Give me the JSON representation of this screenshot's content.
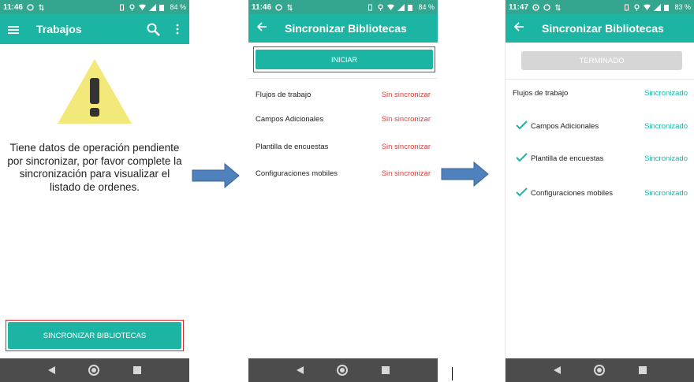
{
  "screen1": {
    "status": {
      "time": "11:46",
      "battery": "84 %"
    },
    "appbar": {
      "title": "Trabajos"
    },
    "message": "Tiene datos de operación pendiente por sincronizar, por favor complete la sincronización para visualizar el listado de ordenes.",
    "sync_button": "SINCRONIZAR BIBLIOTECAS"
  },
  "screen2": {
    "status": {
      "time": "11:46",
      "battery": "84 %"
    },
    "appbar": {
      "title": "Sincronizar Bibliotecas"
    },
    "start_button": "INICIAR",
    "rows": [
      {
        "label": "Flujos de trabajo",
        "status": "Sin sincronizar"
      },
      {
        "label": "Campos Adicionales",
        "status": "Sin sincronizar"
      },
      {
        "label": "Plantilla de encuestas",
        "status": "Sin sincronizar"
      },
      {
        "label": "Configuraciones mobiles",
        "status": "Sin sincronizar"
      }
    ]
  },
  "screen3": {
    "status": {
      "time": "11:47",
      "battery": "83 %"
    },
    "appbar": {
      "title": "Sincronizar Bibliotecas"
    },
    "done_button": "TERMINADO",
    "rows": [
      {
        "label": "Flujos de trabajo",
        "status": "Sincronizado"
      },
      {
        "label": "Campos Adicionales",
        "status": "Sincronizado"
      },
      {
        "label": "Plantilla de encuestas",
        "status": "Sincronizado"
      },
      {
        "label": "Configuraciones mobiles",
        "status": "Sincronizado"
      }
    ]
  },
  "colors": {
    "accent": "#1cb5a3",
    "statusbar": "#34a58e",
    "highlight": "#d32f2f",
    "error": "#e53935",
    "arrow": "#4f81bd"
  }
}
